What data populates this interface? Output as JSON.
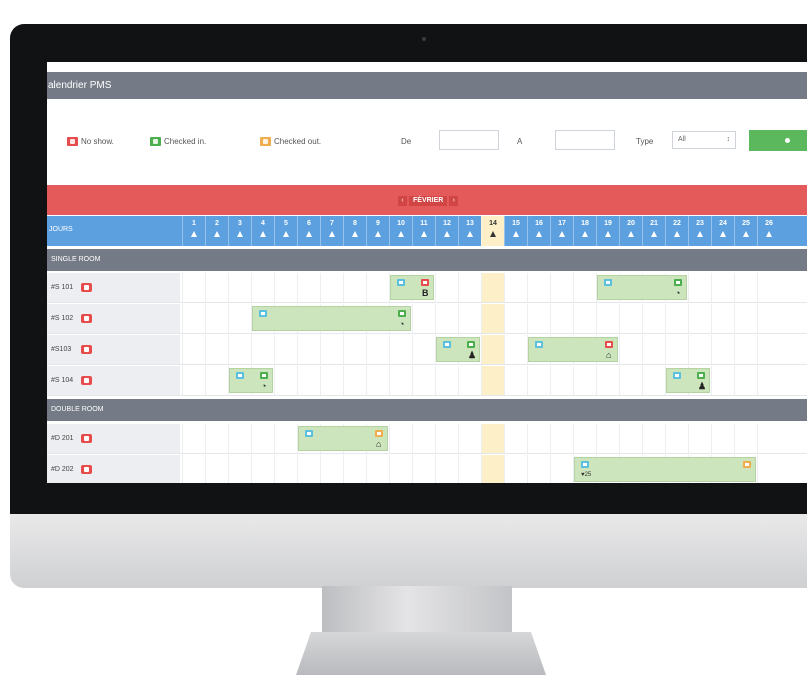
{
  "app": {
    "title": "alendrier PMS"
  },
  "legend": {
    "no_show": "No show.",
    "checked_in": "Checked in.",
    "checked_out": "Checked out."
  },
  "filters": {
    "from_label": "De",
    "to_label": "A",
    "type_label": "Type",
    "type_value": "All",
    "type_arrow": "↕"
  },
  "calendar": {
    "month": "FÉVRIER",
    "prev": "‹",
    "next": "›",
    "days_label": "JOURS",
    "days": [
      "1",
      "2",
      "3",
      "4",
      "5",
      "6",
      "7",
      "8",
      "9",
      "10",
      "11",
      "12",
      "13",
      "14",
      "15",
      "16",
      "17",
      "18",
      "19",
      "20",
      "21",
      "22",
      "23",
      "24",
      "25",
      "26"
    ],
    "today": "14"
  },
  "sections": [
    {
      "name": "SINGLE ROOM",
      "rooms": [
        "#S 101",
        "#S 102",
        "#S103",
        "#S 104"
      ]
    },
    {
      "name": "DOUBLE ROOM",
      "rooms": [
        "#D 201",
        "#D 202"
      ]
    }
  ],
  "booking_glyphs": {
    "b_letter": "B",
    "clock": "◔",
    "house": "⌂",
    "person": "♟",
    "guest_count": "25"
  },
  "colors": {
    "title_bar": "#757b86",
    "month_bar": "#e45a5a",
    "days_row": "#5da0e0",
    "booking": "#cde5bc",
    "today": "#fdf0c8",
    "go_button": "#5cb85c"
  }
}
